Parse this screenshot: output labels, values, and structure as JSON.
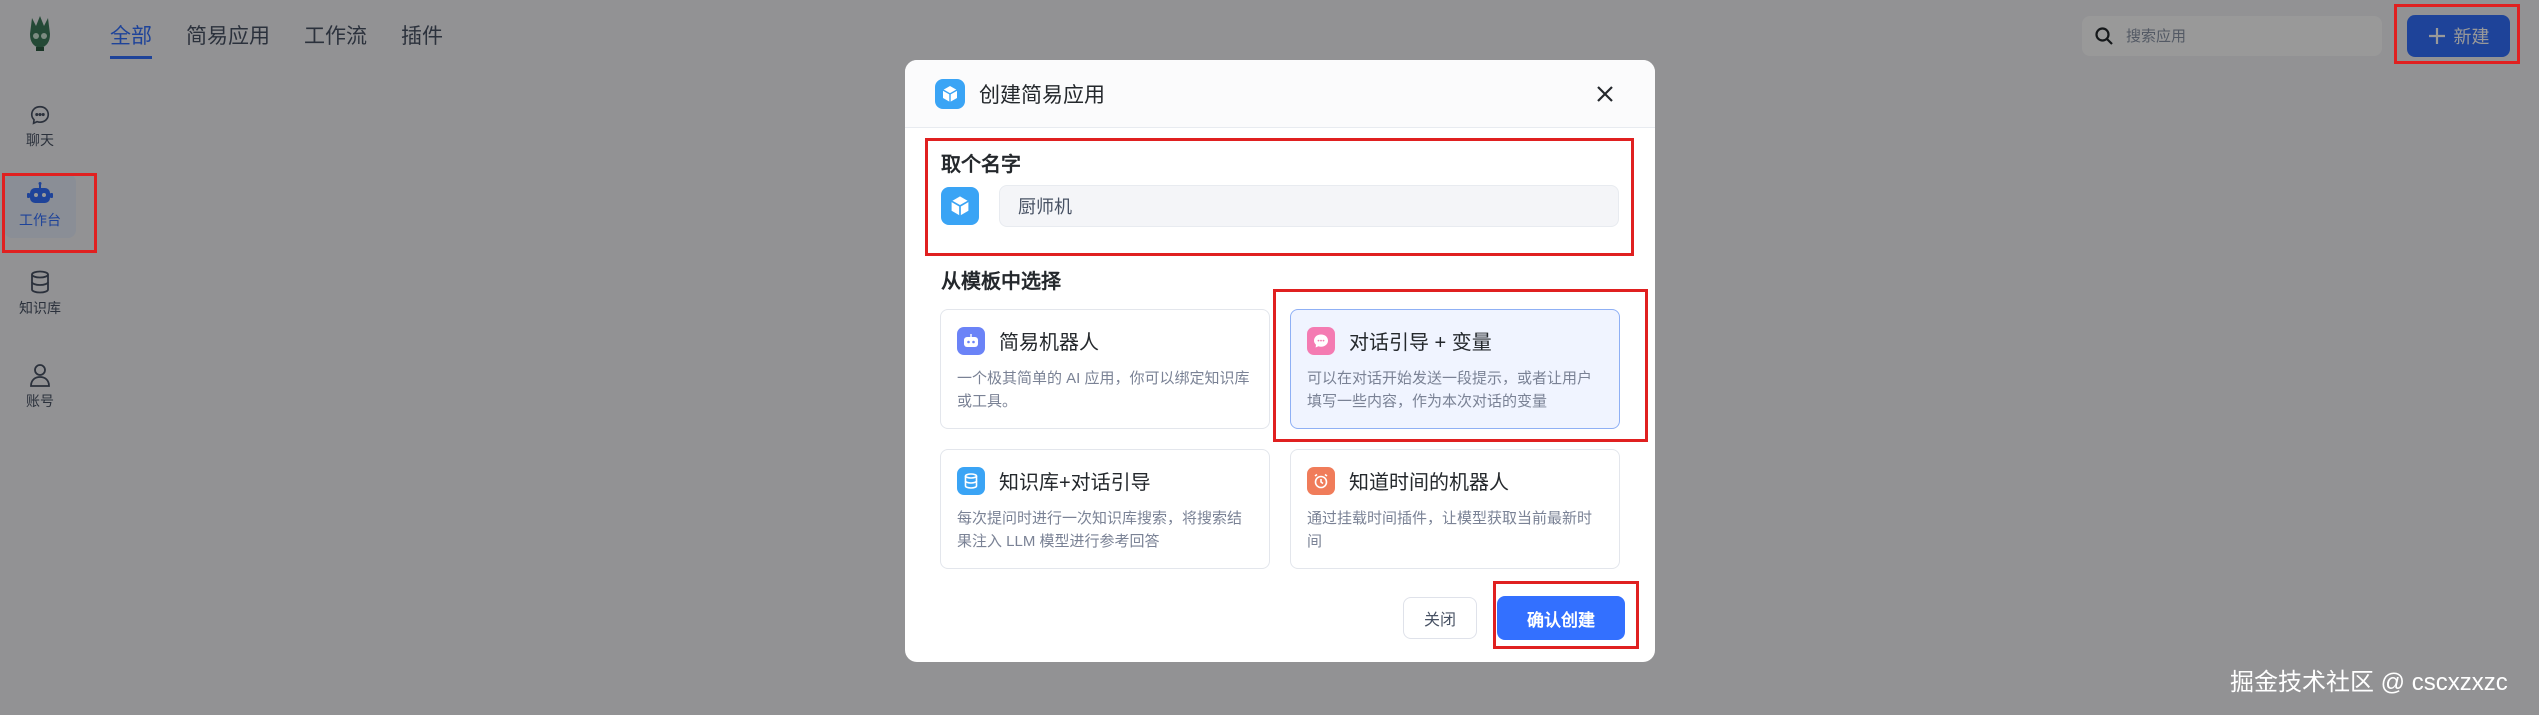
{
  "sidebar": {
    "items": [
      {
        "label": "聊天",
        "icon": "chat-icon"
      },
      {
        "label": "工作台",
        "icon": "robot-icon"
      },
      {
        "label": "知识库",
        "icon": "database-icon"
      },
      {
        "label": "账号",
        "icon": "user-icon"
      }
    ]
  },
  "topnav": {
    "tabs": [
      "全部",
      "简易应用",
      "工作流",
      "插件"
    ],
    "active": "全部"
  },
  "search": {
    "placeholder": "搜索应用"
  },
  "new_button": {
    "label": "新建"
  },
  "modal": {
    "title": "创建简易应用",
    "name_section_title": "取个名字",
    "name_value": "厨师机",
    "template_section_title": "从模板中选择",
    "templates": [
      {
        "title": "简易机器人",
        "desc": "一个极其简单的 AI 应用，你可以绑定知识库或工具。",
        "color": "#6b83f7"
      },
      {
        "title": "对话引导 + 变量",
        "desc": "可以在对话开始发送一段提示，或者让用户填写一些内容，作为本次对话的变量",
        "color": "#f47bb2"
      },
      {
        "title": "知识库+对话引导",
        "desc": "每次提问时进行一次知识库搜索，将搜索结果注入 LLM 模型进行参考回答",
        "color": "#3aa4f5"
      },
      {
        "title": "知道时间的机器人",
        "desc": "通过挂载时间插件，让模型获取当前最新时间",
        "color": "#f07c5a"
      }
    ],
    "close_label": "关闭",
    "confirm_label": "确认创建"
  },
  "watermark": "掘金技术社区 @ cscxzxzc",
  "colors": {
    "accent": "#3370ff",
    "annotation": "#e02020"
  }
}
